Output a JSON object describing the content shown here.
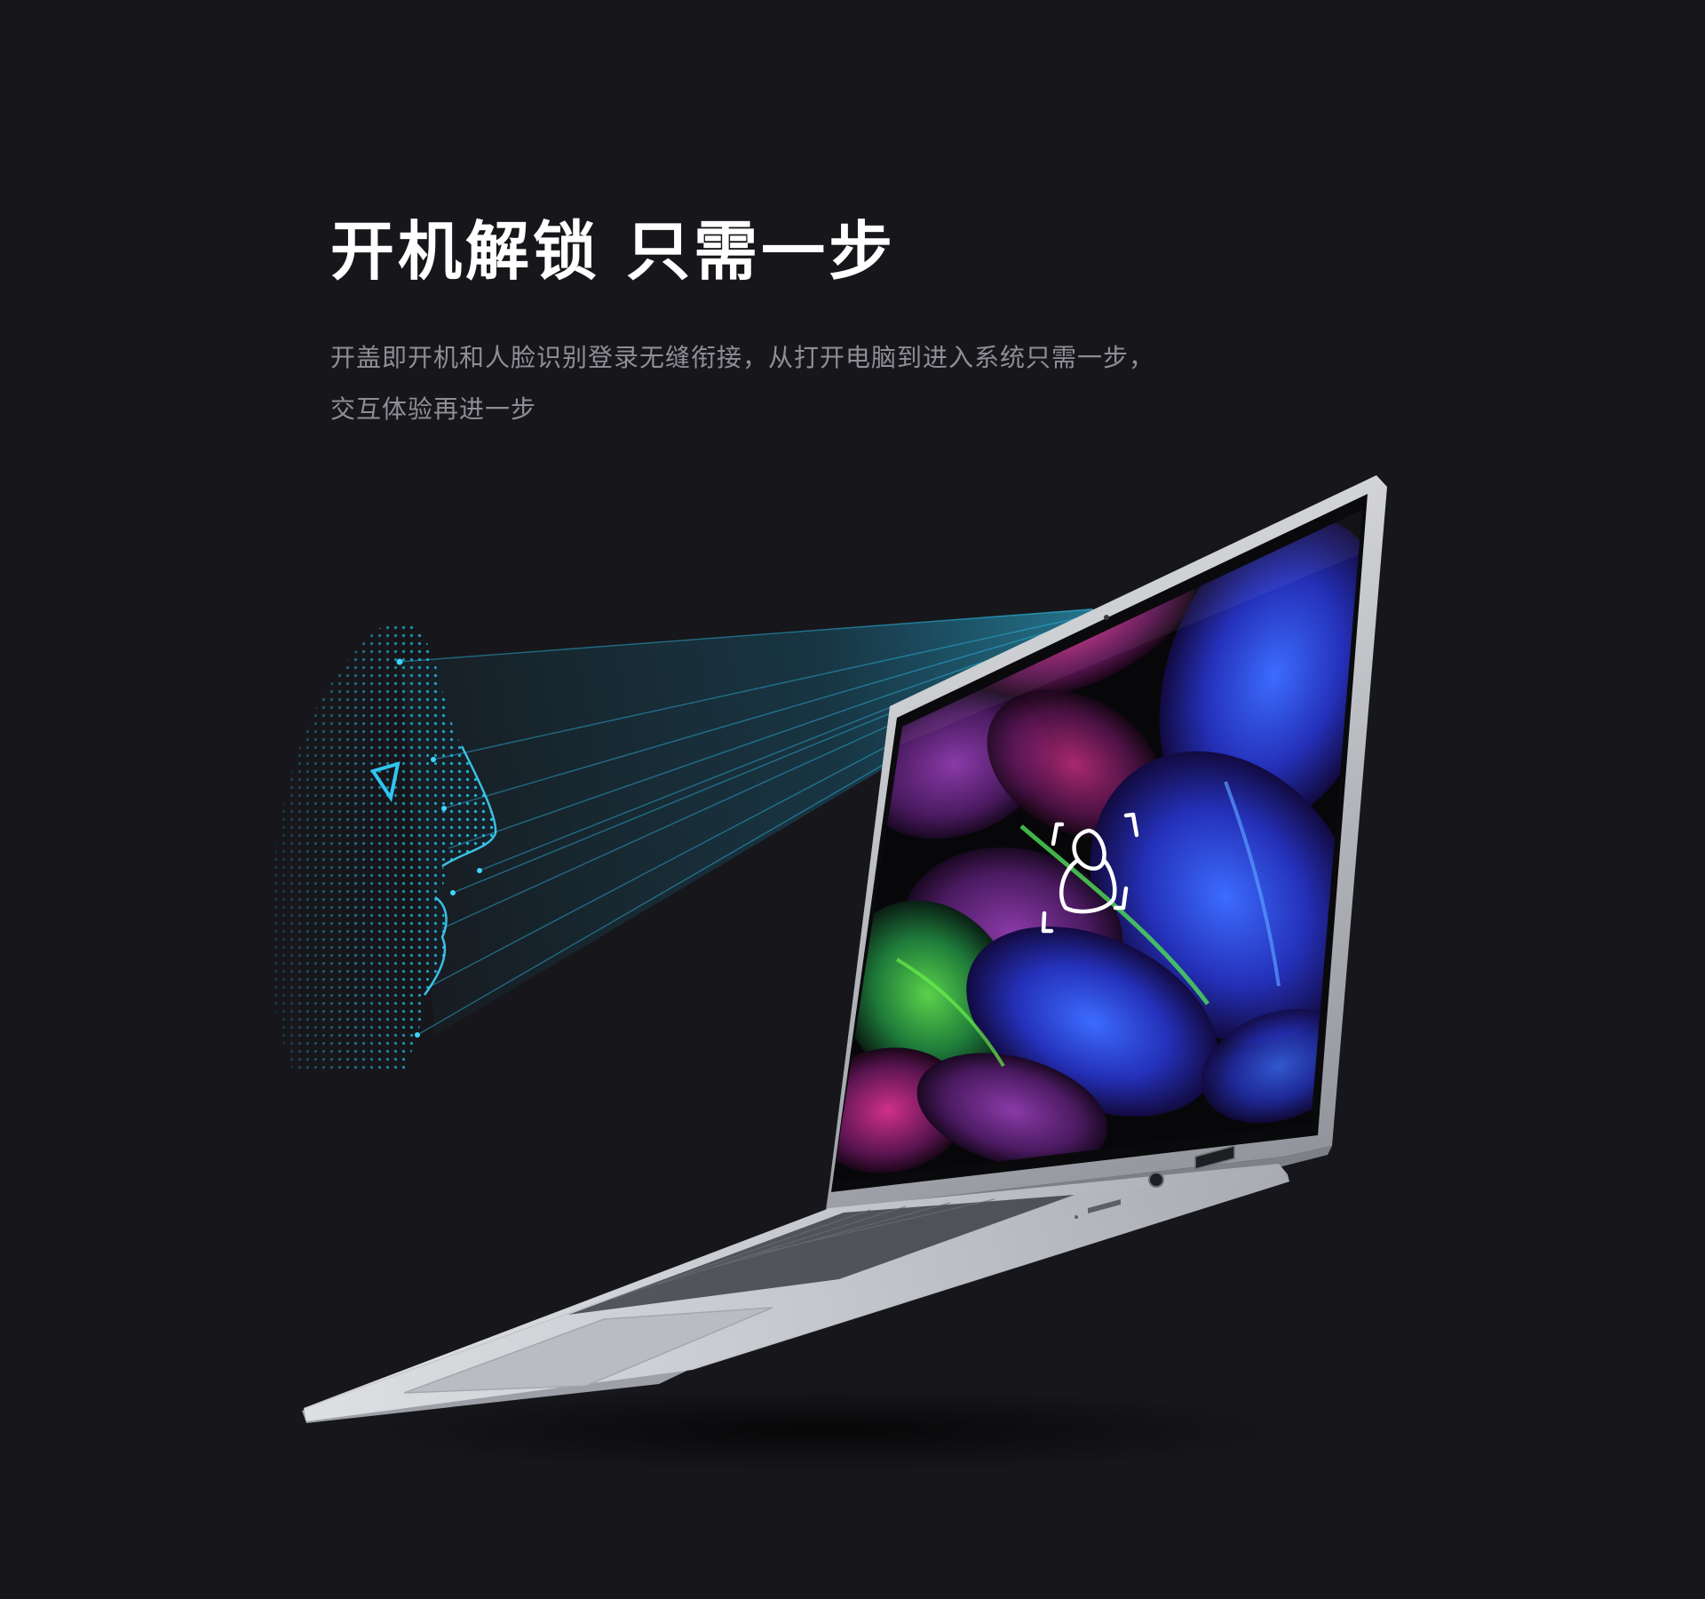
{
  "hero": {
    "title": "开机解锁 只需一步",
    "description_line1": "开盖即开机和人脸识别登录无缝衔接，从打开电脑到进入系统只需一步，",
    "description_line2": "交互体验再进一步"
  },
  "screen": {
    "unlock_icon": "face-recognition-icon"
  },
  "colors": {
    "background": "#17171b",
    "face_scan": "#1ab7e6",
    "laptop_silver": "#c8cbd0"
  }
}
